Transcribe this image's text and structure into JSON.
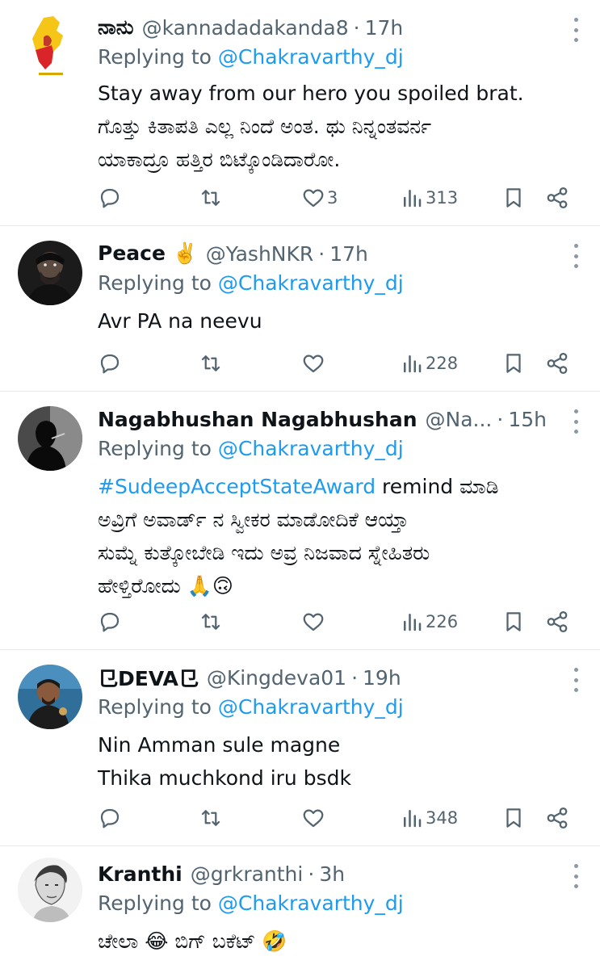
{
  "tweets": [
    {
      "name": "ನಾನು",
      "handle": "@kannadadakanda8",
      "time": "17h",
      "replying_prefix": "Replying to ",
      "replying_to": "@Chakravarthy_dj",
      "lines": [
        "Stay away from our hero you spoiled brat.",
        "ಗೊತ್ತು ಕಿತಾಪತಿ ಎಲ್ಲ ನಿಂದೆ ಅಂತ. ಥು ನಿನ್ನಂತವರ್ನ",
        "ಯಾಕಾದ್ರೂ ಹತ್ತಿರ ಬಿಟ್ಕೊಂಡಿದಾರೋ."
      ],
      "likes": "3",
      "views": "313",
      "avatar_icon": "karnataka-map-avatar"
    },
    {
      "name": "Peace ✌️",
      "handle": "@YashNKR",
      "time": "17h",
      "replying_prefix": "Replying to ",
      "replying_to": "@Chakravarthy_dj",
      "lines": [
        "Avr PA na neevu"
      ],
      "likes": "",
      "views": "228",
      "avatar_icon": "dark-portrait-avatar"
    },
    {
      "name": "Nagabhushan Nagabhushan",
      "handle": "@Na...",
      "time": "15h",
      "replying_prefix": "Replying to ",
      "replying_to": "@Chakravarthy_dj",
      "hashtag": "#SudeepAcceptStateAward",
      "first_line_rest": " remind ಮಾಡಿ",
      "lines": [
        "ಅವ್ರಿಗೆ ಅವಾರ್ಡ್ ನ ಸ್ವೀಕರ ಮಾಡೋದಿಕೆ ಆಯ್ತಾ",
        "ಸುಮ್ನೆ ಕುತ್ಕೋಬೇಡಿ ಇದು ಅವ್ರ ನಿಜವಾದ ಸ್ನೇಹಿತರು",
        "ಹೇಳ್ತಿರೋದು 🙏🙃"
      ],
      "likes": "",
      "views": "226",
      "avatar_icon": "silhouette-avatar"
    },
    {
      "name": "⺋DEVA⺋",
      "handle": "@Kingdeva01",
      "time": "19h",
      "replying_prefix": "Replying to ",
      "replying_to": "@Chakravarthy_dj",
      "lines": [
        "Nin Amman sule magne",
        "Thika muchkond iru bsdk"
      ],
      "likes": "",
      "views": "348",
      "avatar_icon": "man-photo-avatar"
    },
    {
      "name": "Kranthi",
      "handle": "@grkranthi",
      "time": "3h",
      "replying_prefix": "Replying to ",
      "replying_to": "@Chakravarthy_dj",
      "lines": [
        "ಚೇಲಾ 😂 ಬಿಗ್ ಬಕೆಟ್ 🤣"
      ],
      "likes": "",
      "views": "",
      "avatar_icon": "sketch-portrait-avatar"
    }
  ],
  "icons": {
    "reply": "reply-icon",
    "retweet": "retweet-icon",
    "like": "like-icon",
    "views": "views-icon",
    "bookmark": "bookmark-icon",
    "share": "share-icon",
    "more": "more-options-icon"
  },
  "colors": {
    "text": "#0f1419",
    "secondary": "#536471",
    "link": "#1d9bf0",
    "divider": "#e6e8ea"
  }
}
